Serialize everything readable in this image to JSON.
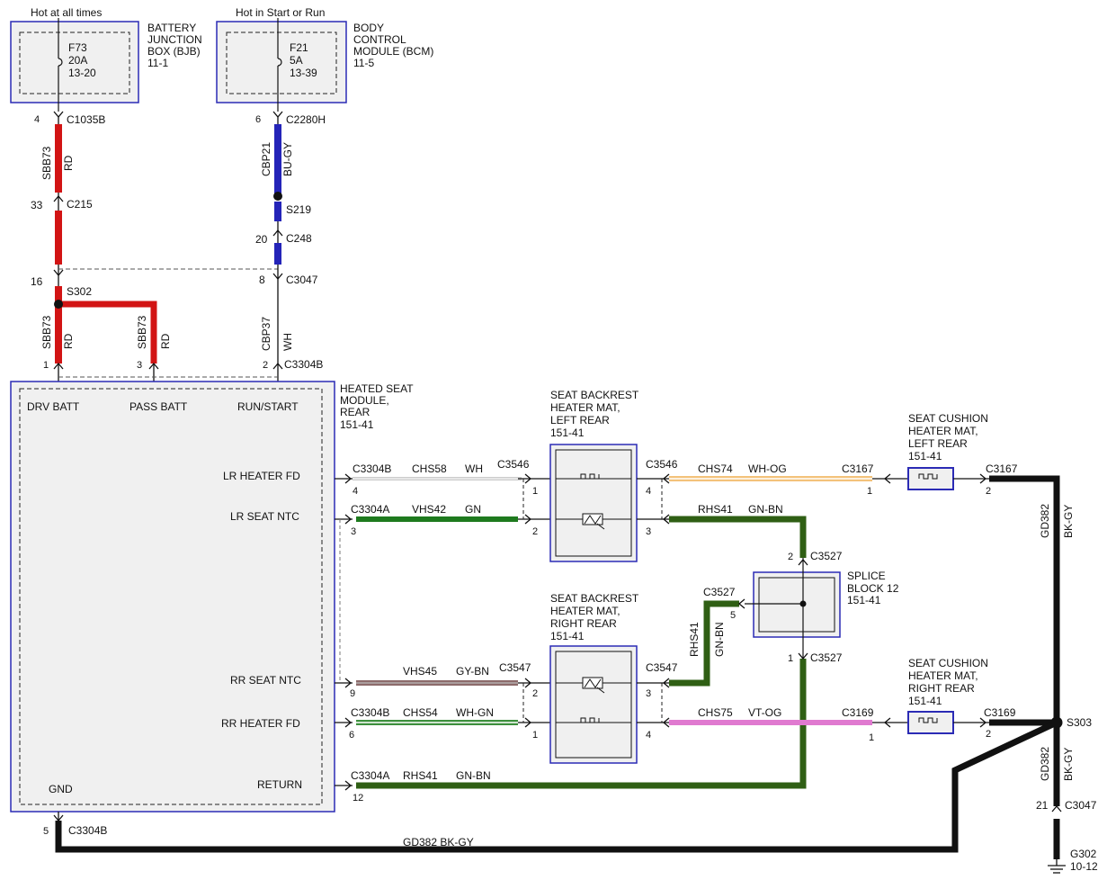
{
  "sources": {
    "hot_always": "Hot at all times",
    "hot_start_run": "Hot in Start or Run"
  },
  "bjb": {
    "fuse": [
      "F73",
      "20A",
      "13-20"
    ],
    "title": [
      "BATTERY",
      "JUNCTION",
      "BOX (BJB)",
      "11-1"
    ]
  },
  "bcm": {
    "fuse": [
      "F21",
      "5A",
      "13-39"
    ],
    "title": [
      "BODY",
      "CONTROL",
      "MODULE (BCM)",
      "11-5"
    ]
  },
  "connectors": {
    "c1035b": "C1035B",
    "c1035b_pin": "4",
    "c2280h": "C2280H",
    "c2280h_pin": "6",
    "c215": "C215",
    "c215_pin": "33",
    "s219": "S219",
    "c248": "C248",
    "c248_pin": "20",
    "c3047_top": "C3047",
    "c3047_top_pin": "8",
    "s302": "S302",
    "s302_pin": "16",
    "c3304b_top": "C3304B",
    "pin1": "1",
    "pin3": "3",
    "pin2": "2",
    "gnd_conn": "C3304B",
    "gnd_pin": "5",
    "s303": "S303",
    "c3047_bot": "C3047",
    "c3047_bot_pin": "21",
    "g302": [
      "G302",
      "10-12"
    ]
  },
  "wires": {
    "sbb73": "SBB73",
    "rd": "RD",
    "cbp21": "CBP21",
    "bu_gy": "BU-GY",
    "cbp37": "CBP37",
    "wh": "WH",
    "gd382": "GD382",
    "bk_gy": "BK-GY",
    "gd382_bottom": "GD382   BK-GY"
  },
  "module": {
    "title": [
      "HEATED SEAT",
      "MODULE,",
      "REAR",
      "151-41"
    ],
    "drv_batt": "DRV BATT",
    "pass_batt": "PASS BATT",
    "run_start": "RUN/START",
    "gnd": "GND",
    "lr_heater_fd": "LR HEATER FD",
    "lr_seat_ntc": "LR SEAT NTC",
    "rr_seat_ntc": "RR SEAT NTC",
    "rr_heater_fd": "RR HEATER FD",
    "return": "RETURN"
  },
  "circuits": {
    "lr_heater": {
      "conn": "C3304B",
      "pin": "4",
      "circuit": "CHS58",
      "color": "WH",
      "conn2": "C3546",
      "pin2": "1"
    },
    "lr_ntc": {
      "conn": "C3304A",
      "pin": "3",
      "circuit": "VHS42",
      "color": "GN",
      "pin2": "2"
    },
    "rr_ntc": {
      "pin": "9",
      "circuit": "VHS45",
      "color": "GY-BN",
      "conn2": "C3547",
      "pin2": "2"
    },
    "rr_heater": {
      "conn": "C3304B",
      "pin": "6",
      "circuit": "CHS54",
      "color": "WH-GN",
      "pin2": "1"
    },
    "return": {
      "conn": "C3304A",
      "pin": "12",
      "circuit": "RHS41",
      "color": "GN-BN"
    }
  },
  "backrest_left": {
    "title": [
      "SEAT BACKREST",
      "HEATER MAT,",
      "LEFT REAR",
      "151-41"
    ],
    "conn_r": "C3546",
    "pin4": "4",
    "pin3": "3"
  },
  "backrest_right": {
    "title": [
      "SEAT BACKREST",
      "HEATER MAT,",
      "RIGHT REAR",
      "151-41"
    ],
    "conn_r": "C3547",
    "pin3": "3",
    "pin4": "4"
  },
  "right_circuits": {
    "chs74": "CHS74",
    "wh_og": "WH-OG",
    "rhs41": "RHS41",
    "gn_bn": "GN-BN",
    "chs75": "CHS75",
    "vt_og": "VT-OG",
    "c3167": "C3167",
    "c3169": "C3169",
    "pin1": "1",
    "pin2": "2"
  },
  "splice": {
    "title": [
      "SPLICE",
      "BLOCK 12",
      "151-41"
    ],
    "c3527": "C3527",
    "pin2": "2",
    "pin5": "5",
    "pin1": "1"
  },
  "cushion_left": {
    "title": [
      "SEAT CUSHION",
      "HEATER MAT,",
      "LEFT REAR",
      "151-41"
    ]
  },
  "cushion_right": {
    "title": [
      "SEAT CUSHION",
      "HEATER MAT,",
      "RIGHT REAR",
      "151-41"
    ]
  }
}
